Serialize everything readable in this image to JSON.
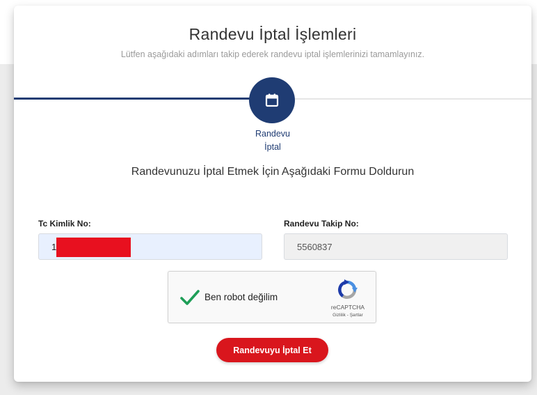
{
  "header": {
    "title": "Randevu İptal İşlemleri",
    "subtitle": "Lütfen aşağıdaki adımları takip ederek randevu iptal işlemlerinizi tamamlayınız."
  },
  "stepper": {
    "step_icon": "calendar-icon",
    "step_label_line1": "Randevu",
    "step_label_line2": "İptal",
    "active_color": "#1f3c73"
  },
  "form": {
    "heading": "Randevunuzu İptal Etmek İçin Aşağıdaki Formu Doldurun",
    "tc_label": "Tc Kimlik No:",
    "tc_value": "1",
    "takip_label": "Randevu Takip No:",
    "takip_value": "5560837"
  },
  "recaptcha": {
    "label": "Ben robot değilim",
    "brand": "reCAPTCHA",
    "links": "Gizlilik - Şartlar",
    "checked": true
  },
  "actions": {
    "cancel_label": "Randevuyu İptal Et",
    "accent_color": "#d9161d"
  }
}
